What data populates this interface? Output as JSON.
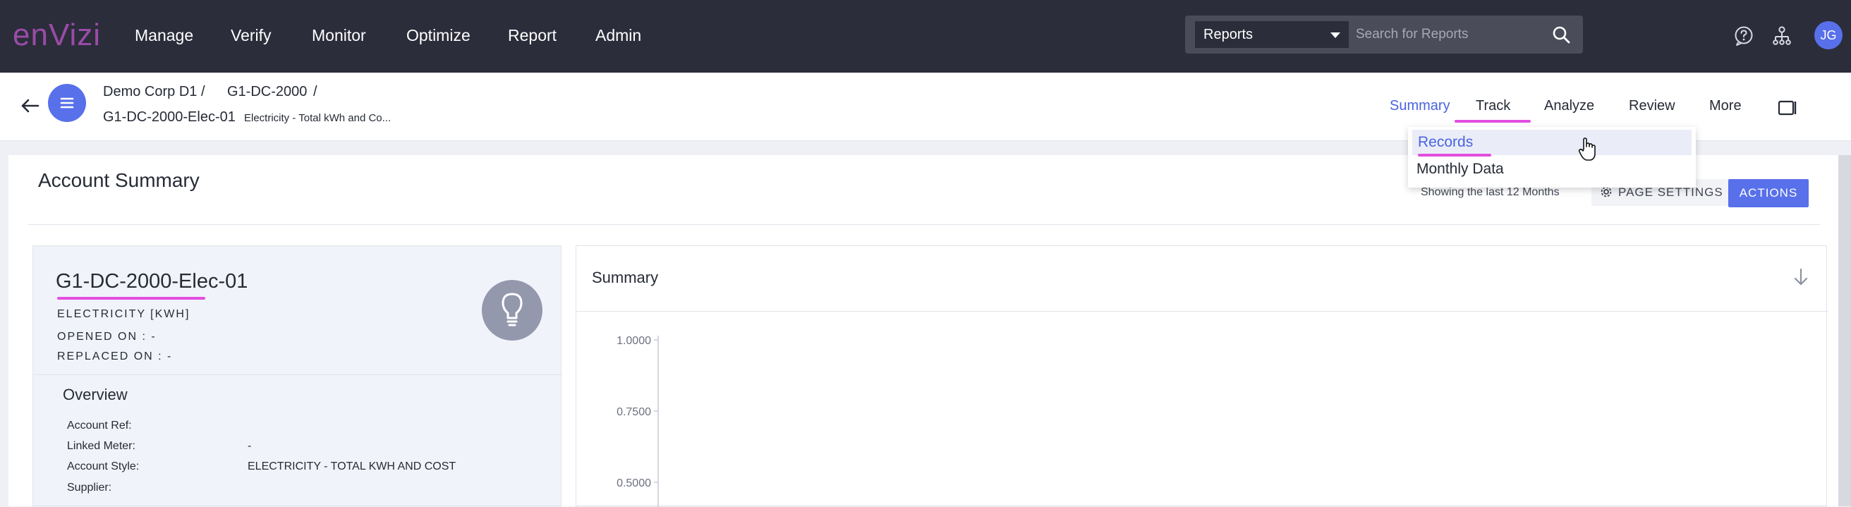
{
  "header": {
    "logo": "enVizi",
    "nav": [
      "Manage",
      "Verify",
      "Monitor",
      "Optimize",
      "Report",
      "Admin"
    ],
    "search": {
      "scope": "Reports",
      "placeholder": "Search for Reports"
    },
    "avatar": "JG",
    "icons": [
      "help-icon",
      "org-tree-icon",
      "search-icon"
    ]
  },
  "breadcrumb": {
    "level1": "Demo Corp D1",
    "level2": "G1-DC-2000",
    "sep": "/",
    "current": "G1-DC-2000-Elec-01",
    "description": "Electricity - Total kWh and Co..."
  },
  "tabs": {
    "items": [
      "Summary",
      "Track",
      "Analyze",
      "Review",
      "More"
    ],
    "active": "Summary"
  },
  "track_menu": {
    "items": [
      "Records",
      "Monthly Data"
    ],
    "highlighted": "Records"
  },
  "page": {
    "title": "Account Summary",
    "showing": "Showing the last 12 Months",
    "page_settings": "PAGE SETTINGS",
    "actions": "ACTIONS"
  },
  "account": {
    "name": "G1-DC-2000-Elec-01",
    "type": "ELECTRICITY [KWH]",
    "opened_on": "OPENED ON : -",
    "replaced_on": "REPLACED ON : -",
    "overview_title": "Overview",
    "fields": [
      {
        "label": "Account Ref:",
        "value": ""
      },
      {
        "label": "Linked Meter:",
        "value": "-"
      },
      {
        "label": "Account Style:",
        "value": "ELECTRICITY - TOTAL KWH AND COST"
      },
      {
        "label": "Supplier:",
        "value": ""
      }
    ]
  },
  "summary": {
    "title": "Summary"
  },
  "chart_data": {
    "type": "line",
    "title": "",
    "xlabel": "",
    "ylabel": "",
    "y_ticks": [
      1.0,
      0.75,
      0.5
    ],
    "y_tick_labels": [
      "1.0000",
      "0.7500",
      "0.5000"
    ],
    "ylim": [
      0,
      1
    ],
    "series": [],
    "grid": false
  },
  "colors": {
    "accent": "#5870ea",
    "highlight_underline": "#e24ee0",
    "topbar": "#2b2d3b",
    "logo": "#9a4ca6"
  }
}
